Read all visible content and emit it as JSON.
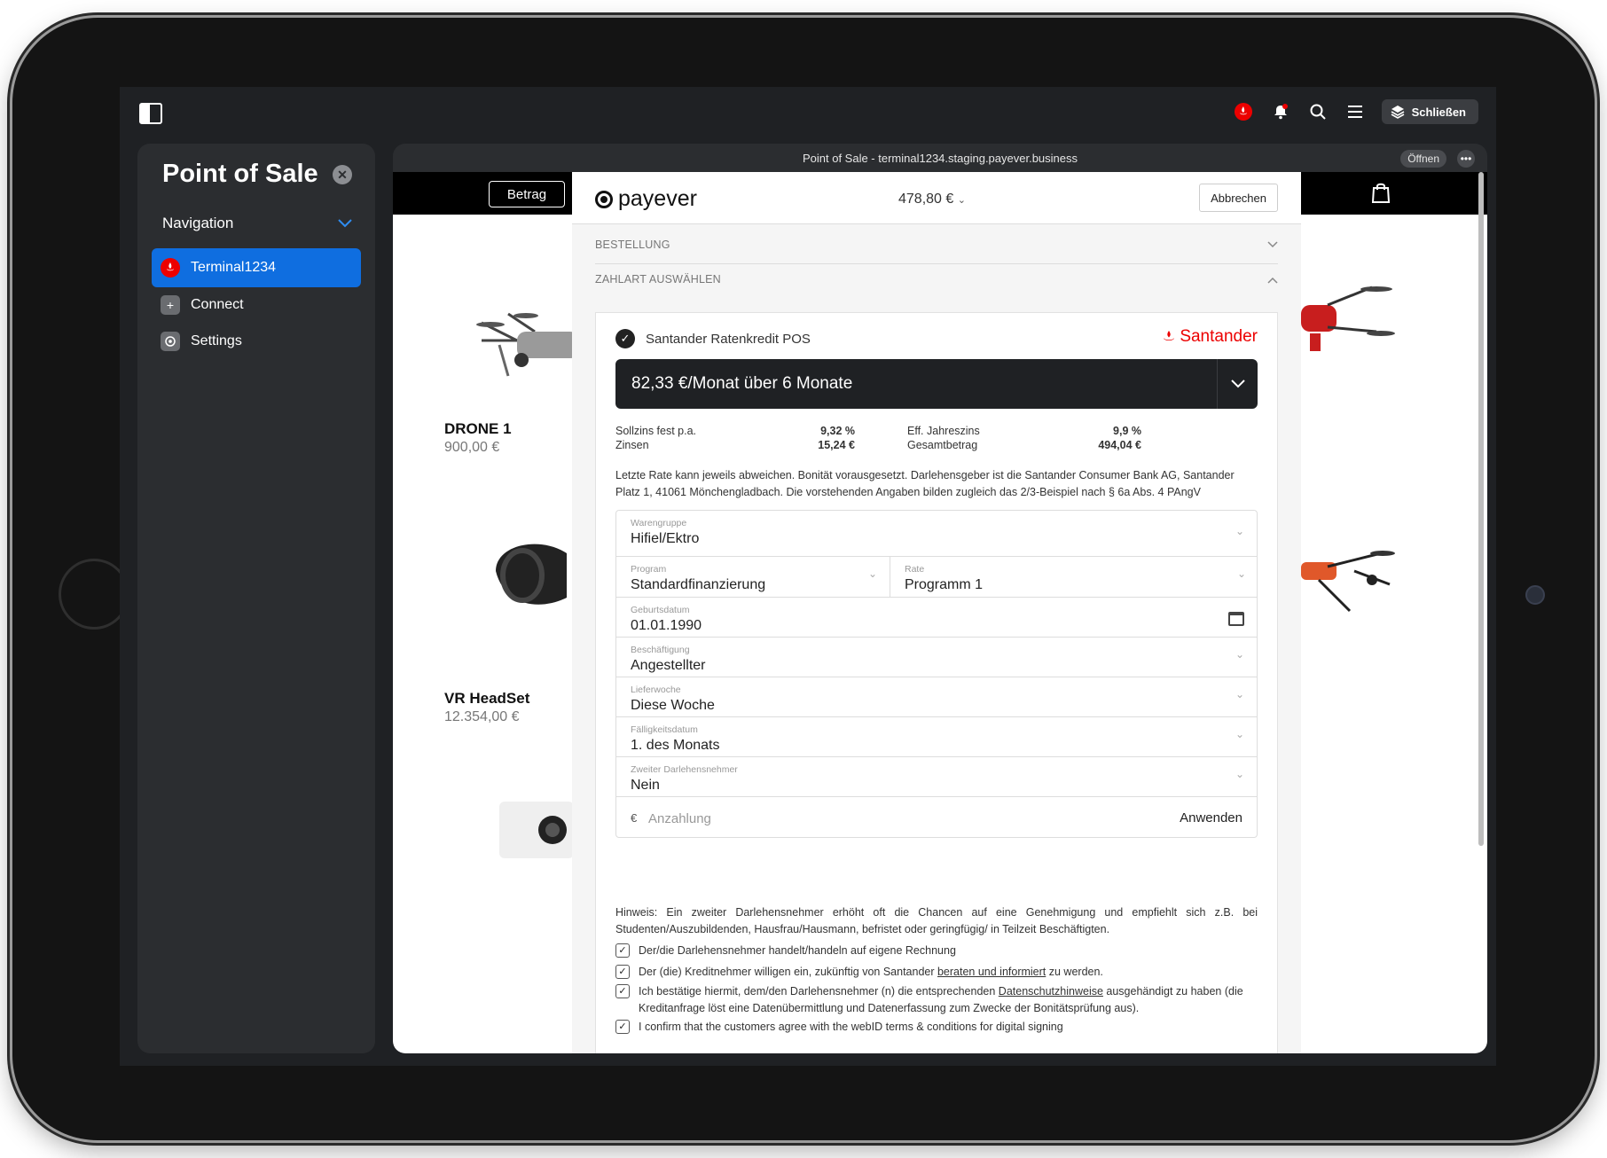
{
  "topbar": {
    "close_label": "Schließen",
    "icons": [
      "panel-toggle-icon",
      "santander-icon",
      "bell-icon",
      "search-icon",
      "menu-icon",
      "stack-icon"
    ]
  },
  "sidebar": {
    "title": "Point of Sale",
    "nav_label": "Navigation",
    "items": [
      {
        "label": "Terminal1234",
        "icon": "santander-icon"
      },
      {
        "label": "Connect",
        "icon": "plus-icon"
      },
      {
        "label": "Settings",
        "icon": "gear-icon"
      }
    ]
  },
  "window": {
    "title": "Point of Sale - terminal1234.staging.payever.business",
    "open_label": "Öffnen"
  },
  "shop": {
    "betrag_label": "Betrag",
    "products": [
      {
        "name": "DRONE 1",
        "price": "900,00 €"
      },
      {
        "name": "VR HeadSet",
        "price": "12.354,00 €"
      }
    ]
  },
  "checkout": {
    "brand": "payever",
    "amount": "478,80 €",
    "cancel_label": "Abbrechen",
    "section_order": "BESTELLUNG",
    "section_payment": "ZAHLART AUSWÄHLEN",
    "method_name": "Santander Ratenkredit POS",
    "provider": "Santander",
    "rate_option": "82,33 €/Monat über 6 Monate",
    "terms": {
      "sollzins_label": "Sollzins fest p.a.",
      "sollzins_value": "9,32 %",
      "zinsen_label": "Zinsen",
      "zinsen_value": "15,24 €",
      "eff_label": "Eff. Jahreszins",
      "eff_value": "9,9 %",
      "gesamt_label": "Gesamtbetrag",
      "gesamt_value": "494,04 €"
    },
    "disclaimer": "Letzte Rate kann jeweils abweichen. Bonität vorausgesetzt. Darlehensgeber ist die Santander Consumer Bank AG, Santander Platz 1, 41061 Mönchengladbach. Die vorstehenden Angaben bilden zugleich das 2/3-Beispiel nach § 6a Abs. 4 PAngV",
    "fields": {
      "warengruppe_label": "Warengruppe",
      "warengruppe_value": "Hifiel/Ektro",
      "program_label": "Program",
      "program_value": "Standardfinanzierung",
      "rate_label": "Rate",
      "rate_value": "Programm 1",
      "geburt_label": "Geburtsdatum",
      "geburt_value": "01.01.1990",
      "beschaeftigung_label": "Beschäftigung",
      "beschaeftigung_value": "Angestellter",
      "lieferwoche_label": "Lieferwoche",
      "lieferwoche_value": "Diese Woche",
      "faelligkeit_label": "Fälligkeitsdatum",
      "faelligkeit_value": "1. des Monats",
      "zweiter_label": "Zweiter Darlehensnehmer",
      "zweiter_value": "Nein",
      "anzahlung_currency": "€",
      "anzahlung_placeholder": "Anzahlung",
      "apply_label": "Anwenden"
    },
    "hint": "Hinweis: Ein zweiter Darlehensnehmer erhöht oft die Chancen auf eine Genehmigung und empfiehlt sich z.B. bei Studenten/Auszubildenden, Hausfrau/Hausmann, befristet oder geringfügig/ in Teilzeit Beschäftigten.",
    "checkboxes": {
      "cb1": "Der/die Darlehensnehmer handelt/handeln auf eigene Rechnung",
      "cb2_pre": "Der (die) Kreditnehmer willigen ein, zukünftig von Santander ",
      "cb2_link": "beraten und informiert",
      "cb2_post": " zu werden.",
      "cb3_pre": "Ich bestätige hiermit, dem/den Darlehensnehmer (n) die entsprechenden ",
      "cb3_link": "Datenschutzhinweise",
      "cb3_post": " ausgehändigt zu haben (die Kreditanfrage löst eine Datenübermittlung und Datenerfassung zum Zwecke der Bonitätsprüfung aus).",
      "cb4": "I confirm that the customers agree with the webID terms & conditions for digital signing"
    }
  }
}
